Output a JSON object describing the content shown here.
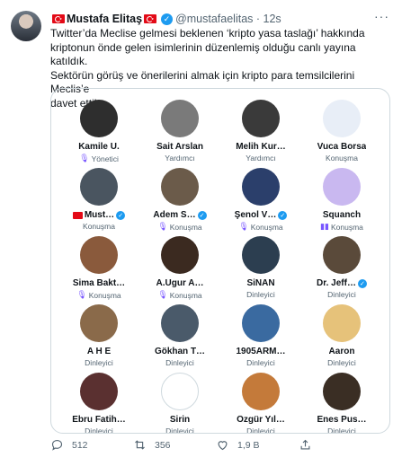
{
  "tweet": {
    "author": "Mustafa Elitaş",
    "handle": "@mustafaelitas",
    "time": "12s",
    "text_line1": "Twitter’da Meclise gelmesi beklenen ‘kripto yasa taslağı’ hakkında",
    "text_line2": "kriptonun önde gelen isimlerinin düzenlemiş olduğu canlı yayına katıldık.",
    "text_line3": "Sektörün görüş ve önerilerini almak için kripto para temsilcilerini Meclis’e",
    "text_line4": "davet ettik."
  },
  "colors": {
    "verified": "#1d9bf0",
    "speaker_icon": "#7856ff",
    "secondary_text": "#536471",
    "border": "#cfd9de"
  },
  "participants": [
    {
      "name": "Kamile U.",
      "role": "Yönetici",
      "role_icon": "speaker-icon",
      "flag": false,
      "verified": false,
      "bg": "#2e2e2e"
    },
    {
      "name": "Sait Arslan",
      "role": "Yardımcı",
      "role_icon": "",
      "flag": false,
      "verified": false,
      "bg": "#7a7a7a"
    },
    {
      "name": "Melih Kur…",
      "role": "Yardımcı",
      "role_icon": "",
      "flag": false,
      "verified": false,
      "bg": "#3a3a3a"
    },
    {
      "name": "Vuca Borsa",
      "role": "Konuşma",
      "role_icon": "",
      "flag": false,
      "verified": false,
      "bg": "#e8eef7"
    },
    {
      "name": "Must…",
      "role": "Konuşma",
      "role_icon": "",
      "flag": true,
      "verified": true,
      "bg": "#4a5560"
    },
    {
      "name": "Adem S…",
      "role": "Konuşma",
      "role_icon": "speaker-icon",
      "flag": false,
      "verified": true,
      "bg": "#6b5b4a"
    },
    {
      "name": "Şenol V…",
      "role": "Konuşma",
      "role_icon": "speaker-icon",
      "flag": false,
      "verified": true,
      "bg": "#2b3f6b"
    },
    {
      "name": "Squanch",
      "role": "Konuşma",
      "role_icon": "bars-icon",
      "flag": false,
      "verified": false,
      "bg": "#c9b8f0"
    },
    {
      "name": "Sima Bakt…",
      "role": "Konuşma",
      "role_icon": "speaker-icon",
      "flag": false,
      "verified": false,
      "bg": "#8a5a3c"
    },
    {
      "name": "A.Ugur A…",
      "role": "Konuşma",
      "role_icon": "speaker-icon",
      "flag": false,
      "verified": false,
      "bg": "#3b2a20"
    },
    {
      "name": "SiNAN",
      "role": "Dinleyici",
      "role_icon": "",
      "flag": false,
      "verified": false,
      "bg": "#2c3e50"
    },
    {
      "name": "Dr. Jeff…",
      "role": "Dinleyici",
      "role_icon": "",
      "flag": false,
      "verified": true,
      "bg": "#5a4a3a"
    },
    {
      "name": "A H E",
      "role": "Dinleyici",
      "role_icon": "",
      "flag": false,
      "verified": false,
      "bg": "#8a6a4a"
    },
    {
      "name": "Gökhan T…",
      "role": "Dinleyici",
      "role_icon": "",
      "flag": false,
      "verified": false,
      "bg": "#4a5a6a"
    },
    {
      "name": "1905ARM…",
      "role": "Dinleyici",
      "role_icon": "",
      "flag": false,
      "verified": false,
      "bg": "#3a6aa0"
    },
    {
      "name": "Aaron",
      "role": "Dinleyici",
      "role_icon": "",
      "flag": false,
      "verified": false,
      "bg": "#e6c27a"
    },
    {
      "name": "Ebru Fatih…",
      "role": "Dinleyici",
      "role_icon": "",
      "flag": false,
      "verified": false,
      "bg": "#5a3030"
    },
    {
      "name": "Sirin",
      "role": "Dinleyici",
      "role_icon": "",
      "flag": false,
      "verified": false,
      "bg": "#ffffff"
    },
    {
      "name": "Özgür Yıl…",
      "role": "Dinleyici",
      "role_icon": "",
      "flag": false,
      "verified": false,
      "bg": "#c47a3a"
    },
    {
      "name": "Enes Pus…",
      "role": "Dinleyici",
      "role_icon": "",
      "flag": false,
      "verified": false,
      "bg": "#3a2e24"
    }
  ],
  "actions": {
    "reply_count": "512",
    "retweet_count": "356",
    "like_count": "1,9 B"
  }
}
